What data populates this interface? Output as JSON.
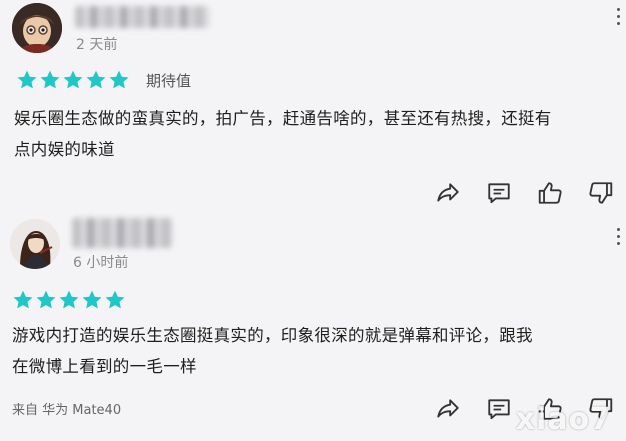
{
  "reviews": [
    {
      "time": "2 天前",
      "rating": 5,
      "tag": "期待值",
      "content_lines": [
        "娱乐圈生态做的蛮真实的，拍广告，赶通告啥的，甚至还有热搜，还挺有",
        "点内娱的味道"
      ]
    },
    {
      "time": "6 小时前",
      "rating": 5,
      "content_lines": [
        "游戏内打造的娱乐生态圈挺真实的，印象很深的就是弹幕和评论，跟我",
        "在微博上看到的一毛一样"
      ],
      "device": "来自 华为 Mate40"
    }
  ],
  "icons": {
    "share": "share-icon",
    "comment": "comment-icon",
    "like": "thumbs-up-icon",
    "dislike": "thumbs-down-icon",
    "more": "more-vertical-icon"
  },
  "colors": {
    "star": "#1ec8c8",
    "background": "#f4f4f6",
    "muted": "#8a8a8e"
  },
  "watermark": "xiao7"
}
